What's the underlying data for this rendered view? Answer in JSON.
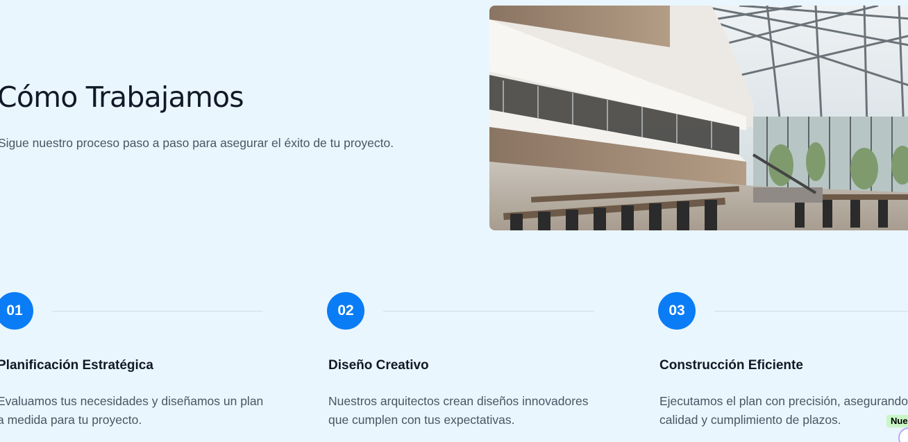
{
  "hero": {
    "title": "Cómo Trabajamos",
    "subtitle": "Sigue nuestro proceso paso a paso para asegurar el éxito de tu proyecto.",
    "image_alt": "Modern atrium interior with glass roof, balconies, tables and chairs"
  },
  "steps": [
    {
      "number": "01",
      "title": "Planificación Estratégica",
      "description_lines": [
        "Evaluamos tus necesidades y diseñamos un plan",
        "a medida para tu proyecto."
      ]
    },
    {
      "number": "02",
      "title": "Diseño Creativo",
      "description_lines": [
        "Nuestros arquitectos crean diseños innovadores",
        "que cumplen con tus expectativas."
      ]
    },
    {
      "number": "03",
      "title": "Construcción Eficiente",
      "description_lines": [
        "Ejecutamos el plan con precisión, asegurando",
        "calidad y cumplimiento de plazos."
      ]
    }
  ],
  "overlay": {
    "new_badge": "Nue",
    "widget_icon": "chat-bubble-icon"
  },
  "colors": {
    "background": "#e9f6fe",
    "accent": "#0a7cf5",
    "heading": "#111827",
    "body_text": "#4b5563",
    "divider": "#d2dde6"
  }
}
